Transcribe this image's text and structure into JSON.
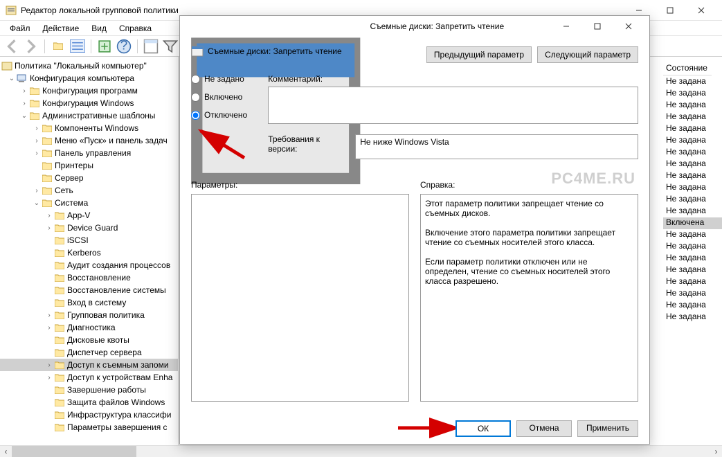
{
  "main": {
    "title": "Редактор локальной групповой политики",
    "menu": [
      "Файл",
      "Действие",
      "Вид",
      "Справка"
    ]
  },
  "tree": {
    "root": "Политика \"Локальный компьютер\"",
    "cfg_computer": "Конфигурация компьютера",
    "cfg_programs": "Конфигурация программ",
    "cfg_windows": "Конфигурация Windows",
    "admin_tpl": "Административные шаблоны",
    "comp_windows": "Компоненты Windows",
    "start_menu": "Меню «Пуск» и панель задач",
    "control_panel": "Панель управления",
    "printers": "Принтеры",
    "server": "Сервер",
    "network": "Сеть",
    "system": "Система",
    "system_children": [
      "App-V",
      "Device Guard",
      "iSCSI",
      "Kerberos",
      "Аудит создания процессов",
      "Восстановление",
      "Восстановление системы",
      "Вход в систему",
      "Групповая политика",
      "Диагностика",
      "Дисковые квоты",
      "Диспетчер сервера",
      "Доступ к съемным запоми",
      "Доступ к устройствам Enha",
      "Завершение работы",
      "Защита файлов Windows",
      "Инфраструктура классифи",
      "Параметры завершения с"
    ]
  },
  "state": {
    "header": "Состояние",
    "values": [
      "Не задана",
      "Не задана",
      "Не задана",
      "Не задана",
      "Не задана",
      "Не задана",
      "Не задана",
      "Не задана",
      "Не задана",
      "Не задана",
      "Не задана",
      "Не задана",
      "Включена",
      "Не задана",
      "Не задана",
      "Не задана",
      "Не задана",
      "Не задана",
      "Не задана",
      "Не задана",
      "Не задана"
    ],
    "selected_index": 12
  },
  "dialog": {
    "title": "Съемные диски: Запретить чтение",
    "subtitle": "Съемные диски: Запретить чтение",
    "prev": "Предыдущий параметр",
    "next": "Следующий параметр",
    "radio": {
      "not_set": "Не задано",
      "enabled": "Включено",
      "disabled": "Отключено",
      "selected": "disabled"
    },
    "comment_label": "Комментарий:",
    "req_label": "Требования к версии:",
    "req_value": "Не ниже Windows Vista",
    "params_label": "Параметры:",
    "help_label": "Справка:",
    "help_text": "Этот параметр политики запрещает чтение со съемных дисков.\n\nВключение этого параметра политики запрещает чтение со съемных носителей этого класса.\n\nЕсли параметр политики отключен или не определен, чтение со съемных носителей этого класса разрешено.",
    "buttons": {
      "ok": "ОК",
      "cancel": "Отмена",
      "apply": "Применить"
    }
  },
  "watermark": "PC4ME.RU"
}
